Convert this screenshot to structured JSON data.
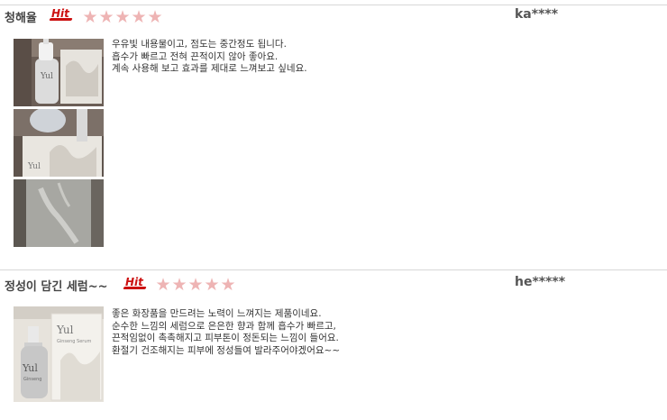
{
  "reviews": [
    {
      "title": "청해율",
      "badge": "Hit",
      "rating": 5,
      "user": "ka****",
      "lines": [
        "우유빛 내용물이고, 점도는 중간정도 됩니다.",
        "흡수가 빠르고 전혀 끈적이지 않아 좋아요.",
        "계속 사용해 보고 효과를 제대로 느껴보고 싶네요."
      ],
      "photo_count": 3
    },
    {
      "title": "정성이 담긴 세럼~~",
      "badge": "Hit",
      "rating": 5,
      "user": "he*****",
      "lines": [
        "좋은 화장품을 만드려는 노력이 느껴지는 제품이네요.",
        "순수한 느낌의 세럼으로 은은한 향과 함께 흡수가 빠르고,",
        "끈적임없이 촉촉해지고 피부톤이 정돈되는 느낌이 들어요.",
        "환절기 건조해지는 피부에 정성들여 발라주어야겠어요~~"
      ],
      "photo_count": 1
    }
  ],
  "colors": {
    "star": "#eeb4b4",
    "hit_badge": "#cc1111",
    "divider": "#d8d8d8"
  },
  "icons": {
    "star": "star-icon",
    "badge": "hit-badge-icon"
  }
}
